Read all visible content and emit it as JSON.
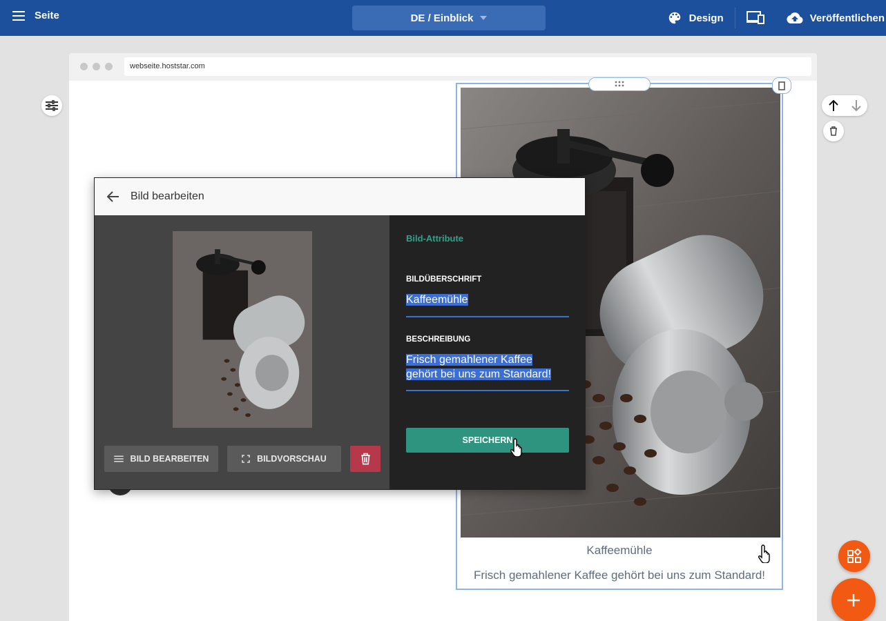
{
  "topbar": {
    "menu_label": "Seite",
    "language_selector": "DE / Einblick",
    "design_label": "Design",
    "publish_label": "Veröffentlichen"
  },
  "browser": {
    "url": "webseite.hoststar.com"
  },
  "image_block": {
    "title": "Kaffeemühle",
    "description": "Frisch gemahlener Kaffee gehört bei uns zum Standard!"
  },
  "dialog": {
    "title": "Bild bearbeiten",
    "edit_button": "BILD BEARBEITEN",
    "preview_button": "BILDVORSCHAU",
    "attributes_heading": "Bild-Attribute",
    "caption_label": "BILDÜBERSCHRIFT",
    "caption_value": "Kaffeemühle",
    "description_label": "BESCHREIBUNG",
    "description_line1": "Frisch gemahlener Kaffee",
    "description_line2": "gehört bei uns zum Standard!",
    "save_button": "SPEICHERN"
  },
  "colors": {
    "topbar": "#1c4f9c",
    "accent_green": "#2e9480",
    "fab_orange": "#f25a14",
    "delete_red": "#b5394a",
    "selection_blue": "#3c6fd1"
  }
}
